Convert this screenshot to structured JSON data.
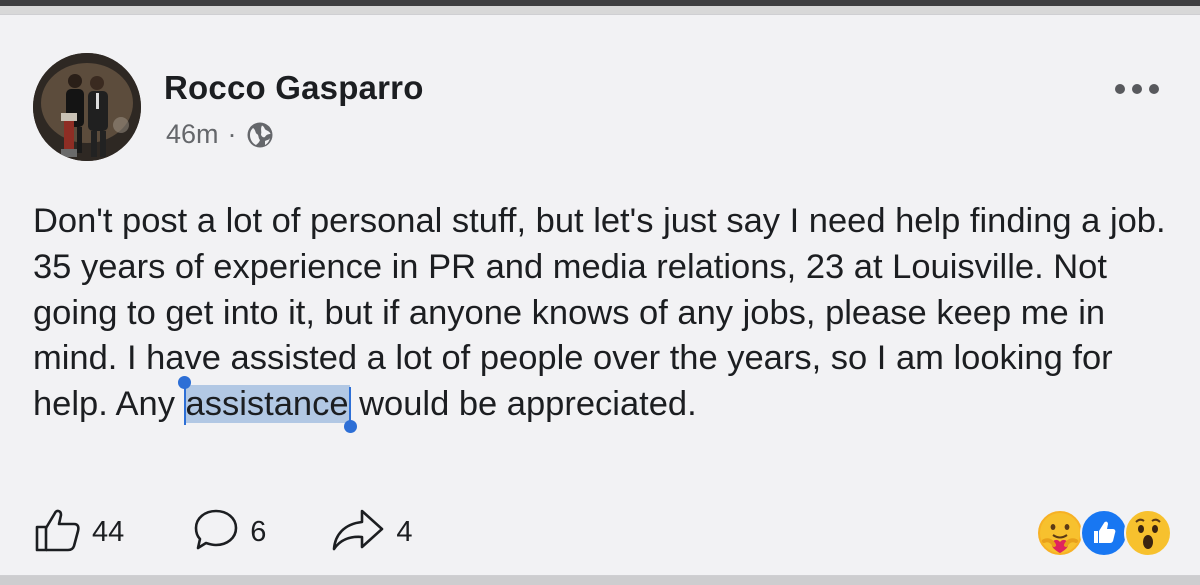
{
  "post": {
    "author": "Rocco Gasparro",
    "time": "46m",
    "separator": "·",
    "privacy_icon": "globe-icon",
    "text_before": "Don't post a lot of personal stuff, but let's just say I need help finding a job.  35 years of experience in PR and media relations, 23 at Louisville. Not going to get into it, but if anyone knows of any jobs, please keep me in mind.  I have assisted a lot of people over the years, so I am looking for help.  Any ",
    "selected_text": "assistance",
    "text_after": " would be appreciated."
  },
  "actions": {
    "likes": "44",
    "comments": "6",
    "shares": "4"
  },
  "reactions": [
    "care-emoji-icon",
    "like-reaction-icon",
    "wow-emoji-icon"
  ],
  "colors": {
    "background": "#f2f2f4",
    "text": "#1c1e21",
    "meta_text": "#65676b",
    "selection": "#b2c8e4",
    "selection_handle": "#2d6fd6",
    "like_blue": "#1877f2"
  }
}
